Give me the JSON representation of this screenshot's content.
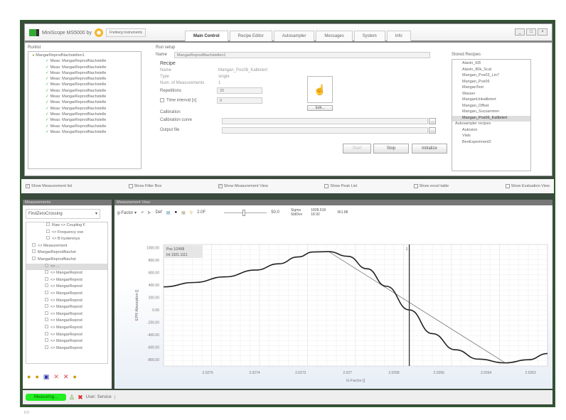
{
  "app": {
    "title": "MiniScope MS5000 by",
    "brand": "Freiberg Instruments"
  },
  "tabs": [
    "Main Control",
    "Recipe Editor",
    "Autosampler",
    "Messages",
    "System",
    "Info"
  ],
  "window_buttons": [
    "_",
    "□",
    "×"
  ],
  "runlist": {
    "label": "Runlist",
    "root": "MangarReprodNachstellen1",
    "items": [
      "Meas: MangarReprodNachstelle",
      "Meas: MangarReprodNachstelle",
      "Meas: MangarReprodNachstelle",
      "Meas: MangarReprodNachstelle",
      "Meas: MangarReprodNachstelle",
      "Meas: MangarReprodNachstelle",
      "Meas: MangarReprodNachstelle",
      "Meas: MangarReprodNachstelle",
      "Meas: MangarReprodNachstelle",
      "Meas: MangarReprodNachstelle",
      "Meas: MangarReprodNachstelle",
      "Meas: MangarReprodNachstelle",
      "Meas: MangarReprodNachstelle"
    ]
  },
  "run_setup": {
    "label": "Run setup",
    "name_label": "Name",
    "name_value": "MangarReprodNachstellen1",
    "recipe_label": "Recipe",
    "recipe_name_label": "Name",
    "recipe_name": "Mangan_Pos06_Kalibriert",
    "type_label": "Type",
    "type_value": "single",
    "num_label": "Num. of Measurements",
    "num_value": "1",
    "repetitions_label": "Repetitions",
    "repetitions_value": "20",
    "interval_label": "Time interval [s]",
    "interval_value": "0",
    "edit_label": "Edit...",
    "calibration_label": "Calibration",
    "curve_label": "Calibration curve",
    "output_label": "Output file",
    "start": "Start",
    "stop": "Stop",
    "initialize": "Initialize"
  },
  "stored": {
    "label": "Stored Recipes",
    "items": [
      "Alanin_6/8",
      "Alanin_80k_Scal",
      "Mangan_Pos03_Lin7",
      "Mangan_Pos06",
      "ManganTest",
      "Wasser",
      "ManganUnkalibriert",
      "Mangan_Offset",
      "Mangan_Sucsammer",
      "Mangan_Pos06_Kalibriert"
    ],
    "selected": 9,
    "auto_label": "Autosampler recipes",
    "auto_items": [
      "Autosion",
      "Vials",
      "BeeExperiment2"
    ]
  },
  "checkboxes": [
    {
      "label": "Show Measurement list",
      "checked": true
    },
    {
      "label": "Show Filter Box",
      "checked": false
    },
    {
      "label": "Show Measurement View",
      "checked": true
    },
    {
      "label": "Show Peak List",
      "checked": false
    },
    {
      "label": "Show excel table",
      "checked": false
    },
    {
      "label": "Show Evaluation View",
      "checked": false
    }
  ],
  "measurements": {
    "label": "Measurements",
    "dropdown": "FindZeroCrossing",
    "items": [
      "Raw <> Coupling F",
      "<> Frequency ove",
      "<> B hysteresys",
      "<> Measurement",
      "MangarReprodNachst",
      "MangarReprodNachst",
      "<> ...",
      "<> MangarReprod",
      "<> MangarReprod",
      "<> MangarReprod",
      "<> MangarReprod",
      "<> MangarReprod",
      "<> MangarReprod",
      "<> MangarReprod",
      "<> MangarReprod",
      "<> MangarReprod",
      "<> MangarReprod",
      "<> MangarReprod",
      "<> MangarReprod"
    ]
  },
  "view": {
    "label": "Measurement View",
    "toolbar": {
      "factor": "g-Factor",
      "def": "Def",
      "zoom": "2.0F",
      "slider_value": "50.0",
      "sigma_label": "Sigma",
      "stddev_label": "StdDev",
      "sigma_value": "1828.918",
      "extra_value": "361.88",
      "stddev_value": "18.92"
    },
    "info": [
      "Pos 1/2458",
      "Int 1921.1111"
    ],
    "cursor_label": "1"
  },
  "chart_data": {
    "type": "line",
    "xlabel": "G-Factor []",
    "ylabel": "EPR Absorption []",
    "xlim": [
      0,
      100
    ],
    "ylim": [
      -900,
      1050
    ],
    "xticks": [
      {
        "x": 11.5,
        "label": "2.0276"
      },
      {
        "x": 23.7,
        "label": "2.0274"
      },
      {
        "x": 35.7,
        "label": "2.0272"
      },
      {
        "x": 47.9,
        "label": "2.027"
      },
      {
        "x": 60,
        "label": "2.0268"
      },
      {
        "x": 71.7,
        "label": "2.0266"
      },
      {
        "x": 84,
        "label": "2.0264"
      },
      {
        "x": 95.6,
        "label": "2.0262"
      }
    ],
    "yticks": [
      1000,
      800,
      600,
      400,
      200,
      0,
      -200,
      -400,
      -600,
      -800
    ],
    "cursor_x": 64,
    "series": [
      {
        "name": "spectrum",
        "points": [
          [
            0,
            370
          ],
          [
            8,
            440
          ],
          [
            16,
            530
          ],
          [
            24,
            640
          ],
          [
            30,
            740
          ],
          [
            35,
            850
          ],
          [
            39,
            930
          ],
          [
            43,
            935
          ],
          [
            48,
            860
          ],
          [
            53,
            660
          ],
          [
            58,
            380
          ],
          [
            64,
            0
          ],
          [
            70,
            -380
          ],
          [
            76,
            -640
          ],
          [
            82,
            -790
          ],
          [
            89,
            -850
          ],
          [
            95,
            -800
          ],
          [
            100,
            -700
          ]
        ]
      },
      {
        "name": "fit",
        "points": [
          [
            43,
            935
          ],
          [
            89,
            -850
          ]
        ]
      }
    ]
  },
  "status": {
    "state": "Measuring...",
    "user": "User: Service"
  },
  "footer": "0.0"
}
